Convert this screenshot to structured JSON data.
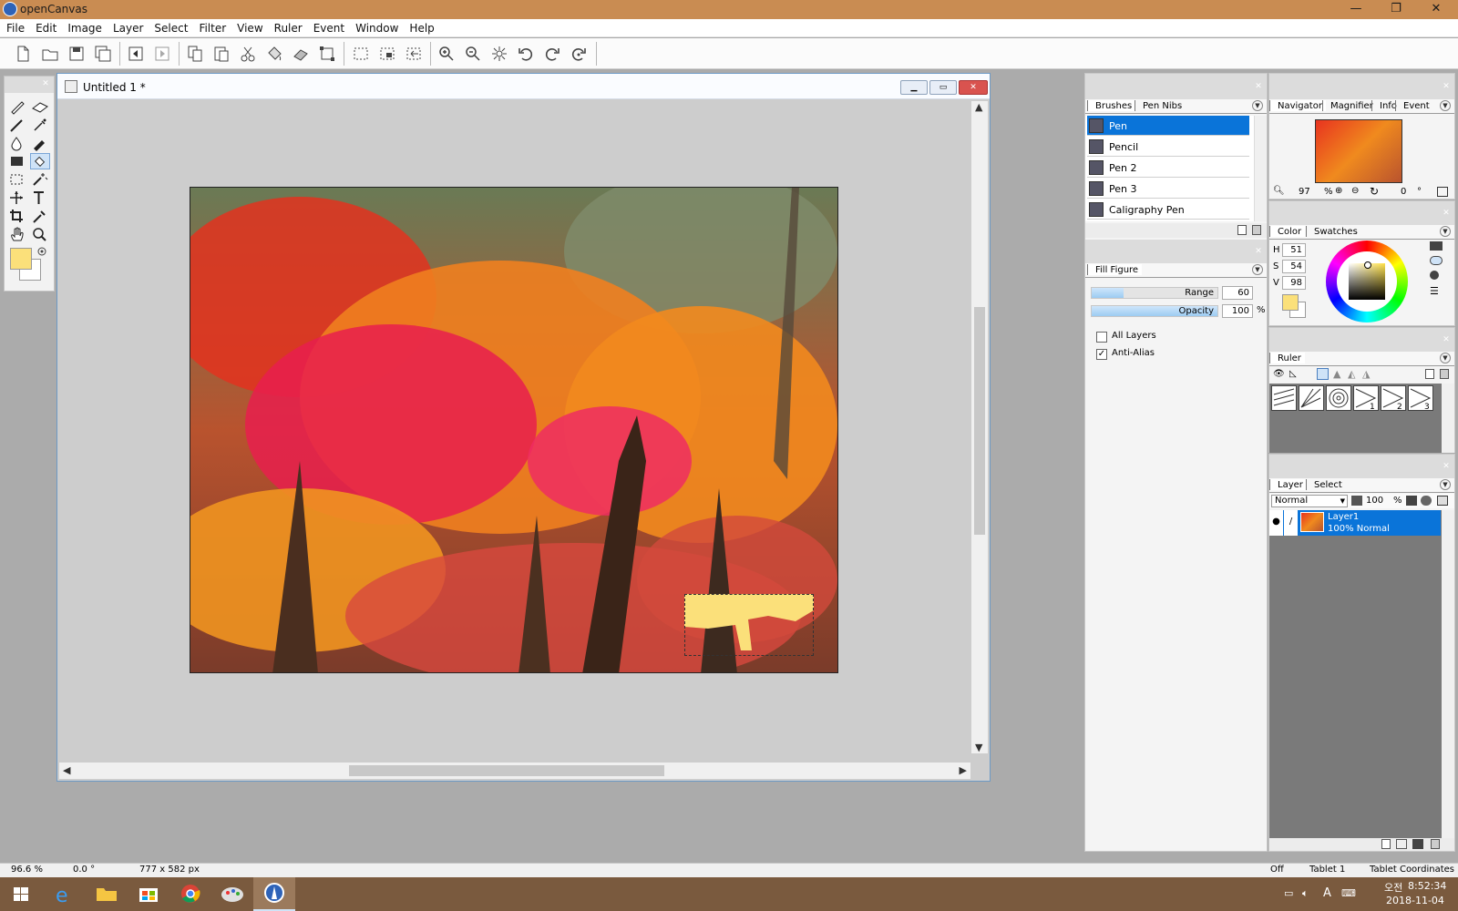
{
  "window": {
    "app_title": "openCanvas",
    "controls": [
      "—",
      "❐",
      "✕"
    ]
  },
  "menu": [
    "File",
    "Edit",
    "Image",
    "Layer",
    "Select",
    "Filter",
    "View",
    "Ruler",
    "Event",
    "Window",
    "Help"
  ],
  "document": {
    "title": "Untitled 1 *"
  },
  "brushes_panel": {
    "tabs": [
      "Brushes",
      "Pen Nibs"
    ],
    "items": [
      "Pen",
      "Pencil",
      "Pen 2",
      "Pen 3",
      "Caligraphy Pen"
    ],
    "selected": "Pen"
  },
  "fill_panel": {
    "tab": "Fill Figure",
    "range_label": "Range",
    "range_value": "60",
    "range_fraction": 0.25,
    "opacity_label": "Opacity",
    "opacity_value": "100",
    "opacity_unit": "%",
    "opacity_fraction": 1.0,
    "all_layers_label": "All Layers",
    "all_layers_checked": false,
    "anti_alias_label": "Anti-Alias",
    "anti_alias_checked": true
  },
  "navigator_panel": {
    "tabs": [
      "Navigator",
      "Magnifier",
      "Info",
      "Event"
    ],
    "zoom_value": "97",
    "zoom_unit": "%",
    "rotation_value": "0",
    "rotation_unit": "°"
  },
  "color_panel": {
    "tabs": [
      "Color",
      "Swatches"
    ],
    "h_label": "H",
    "h_value": "51",
    "s_label": "S",
    "s_value": "54",
    "v_label": "V",
    "v_value": "98",
    "foreground": "#fbe07a",
    "background": "#ffffff"
  },
  "ruler_panel": {
    "tab": "Ruler",
    "presets": [
      "",
      "",
      "",
      "1",
      "2",
      "3"
    ]
  },
  "layer_panel": {
    "tabs": [
      "Layer",
      "Select"
    ],
    "blend_mode": "Normal",
    "opacity": "100",
    "opacity_unit": "%",
    "layers": [
      {
        "name": "Layer1",
        "info": "100% Normal"
      }
    ]
  },
  "status": {
    "zoom": "96.6 %",
    "angle": "0.0 °",
    "size": "777 x 582 px",
    "off": "Off",
    "tablet": "Tablet 1",
    "coords": "Tablet Coordinates"
  },
  "taskbar": {
    "time": "8:52:34",
    "ampm": "오전",
    "date": "2018-11-04",
    "ime": "A"
  },
  "colors": {
    "titlebar": "#c98c52",
    "taskbar": "#7a5a3e",
    "selection_blue": "#0a74d9",
    "fill_yellow": "#fbe07a"
  }
}
